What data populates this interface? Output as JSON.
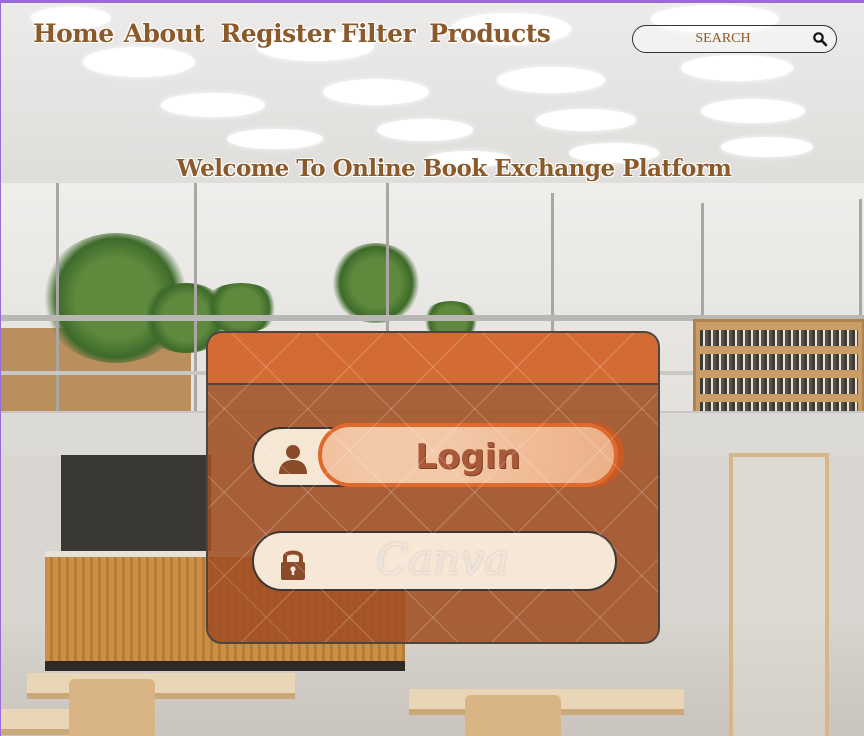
{
  "nav": {
    "items": [
      "Home",
      "About",
      "Register",
      "Filter",
      "Products"
    ]
  },
  "search": {
    "placeholder": "SEARCH",
    "icon": "search-icon"
  },
  "hero": {
    "title": "Welcome To Online Book Exchange Platform"
  },
  "login_card": {
    "username_icon": "user-icon",
    "password_icon": "lock-icon",
    "login_label": "Login",
    "watermark": "Canva"
  },
  "colors": {
    "brand_text": "#8b5a2b",
    "card_body": "#a04e22",
    "card_header": "#d96c34",
    "field_bg": "#f6e6d4",
    "login_border": "#e06a2d",
    "login_text": "#a85a3a",
    "icon": "#8a4b2b"
  }
}
